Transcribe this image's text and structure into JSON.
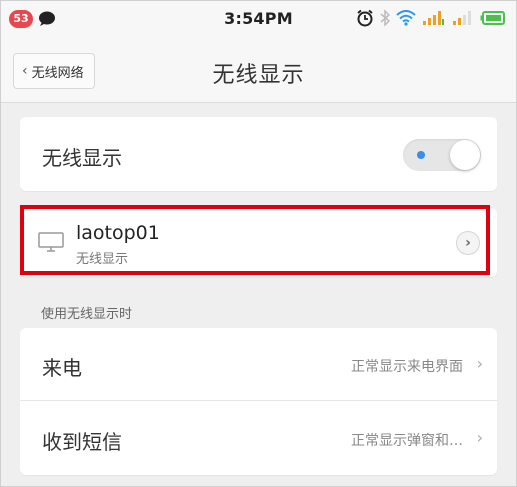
{
  "status_bar": {
    "notification_count": "53",
    "time": "3:54PM",
    "icons": [
      "chat-icon",
      "alarm-icon",
      "bluetooth-icon",
      "wifi-icon",
      "signal-icon",
      "signal-icon",
      "battery-icon"
    ],
    "colors": {
      "badge": "#e8474f",
      "wifi": "#2a9ae8",
      "signal": "#f0a020",
      "battery": "#4cc04c"
    }
  },
  "header": {
    "back_label": "无线网络",
    "title": "无线显示"
  },
  "wireless_display": {
    "label": "无线显示",
    "toggle_state": "on"
  },
  "device": {
    "name": "laotop01",
    "subtitle": "无线显示",
    "icon": "monitor-icon",
    "highlight_color": "#e0000d"
  },
  "section": {
    "header": "使用无线显示时"
  },
  "settings": [
    {
      "label": "来电",
      "value": "正常显示来电界面"
    },
    {
      "label": "收到短信",
      "value": "正常显示弹窗和…"
    }
  ]
}
